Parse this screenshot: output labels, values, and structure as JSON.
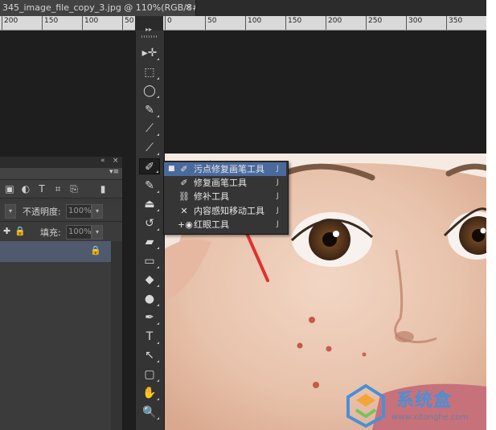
{
  "document": {
    "tab_title": "345_image_file_copy_3.jpg @ 110%(RGB/8#) *",
    "close_glyph": "×"
  },
  "ruler_left": {
    "ticks": [
      "200",
      "150",
      "100",
      "50"
    ]
  },
  "ruler_right": {
    "ticks": [
      "0",
      "50",
      "100",
      "150",
      "200",
      "250",
      "300",
      "350"
    ]
  },
  "layers_panel": {
    "top_collapse": "«",
    "top_close": "×",
    "menu_glyph": "▾≡",
    "opacity_label": "不透明度:",
    "opacity_value": "100%",
    "fill_label": "填充:",
    "fill_value": "100%",
    "dropdown_arrow": "▾",
    "lock_glyph": "🔒"
  },
  "toolbar": {
    "collapse_glyph": "▸▸",
    "tools": [
      {
        "name": "move-tool",
        "glyph": "▸✛"
      },
      {
        "name": "marquee-tool",
        "glyph": "⬚"
      },
      {
        "name": "lasso-tool",
        "glyph": "◯"
      },
      {
        "name": "quick-selection-tool",
        "glyph": "✎"
      },
      {
        "name": "crop-tool",
        "glyph": "⟋"
      },
      {
        "name": "eyedropper-tool",
        "glyph": "⟋"
      },
      {
        "name": "spot-healing-brush-tool",
        "glyph": "✐"
      },
      {
        "name": "brush-tool",
        "glyph": "✎"
      },
      {
        "name": "clone-stamp-tool",
        "glyph": "⏏"
      },
      {
        "name": "history-brush-tool",
        "glyph": "↺"
      },
      {
        "name": "eraser-tool",
        "glyph": "▰"
      },
      {
        "name": "gradient-tool",
        "glyph": "▭"
      },
      {
        "name": "blur-tool",
        "glyph": "◆"
      },
      {
        "name": "dodge-tool",
        "glyph": "●"
      },
      {
        "name": "pen-tool",
        "glyph": "✒"
      },
      {
        "name": "type-tool",
        "glyph": "T"
      },
      {
        "name": "path-selection-tool",
        "glyph": "↖"
      },
      {
        "name": "shape-tool",
        "glyph": "▢"
      },
      {
        "name": "hand-tool",
        "glyph": "✋"
      },
      {
        "name": "zoom-tool",
        "glyph": "🔍"
      }
    ]
  },
  "flyout": {
    "items": [
      {
        "label": "污点修复画笔工具",
        "key": "J",
        "selected": true,
        "bullet": "■",
        "icon": "✐"
      },
      {
        "label": "修复画笔工具",
        "key": "J",
        "selected": false,
        "bullet": "",
        "icon": "✐"
      },
      {
        "label": "修补工具",
        "key": "J",
        "selected": false,
        "bullet": "",
        "icon": "⛓"
      },
      {
        "label": "内容感知移动工具",
        "key": "J",
        "selected": false,
        "bullet": "",
        "icon": "✕"
      },
      {
        "label": "红眼工具",
        "key": "J",
        "selected": false,
        "bullet": "",
        "icon": "+◉"
      }
    ]
  },
  "watermark": {
    "brand": "系统盒",
    "url": "www.xitonghe.com"
  },
  "colors": {
    "flyout_highlight": "#4a6a9c",
    "annotation_arrow": "#e0302c",
    "watermark_blue": "#4a8fd6"
  }
}
